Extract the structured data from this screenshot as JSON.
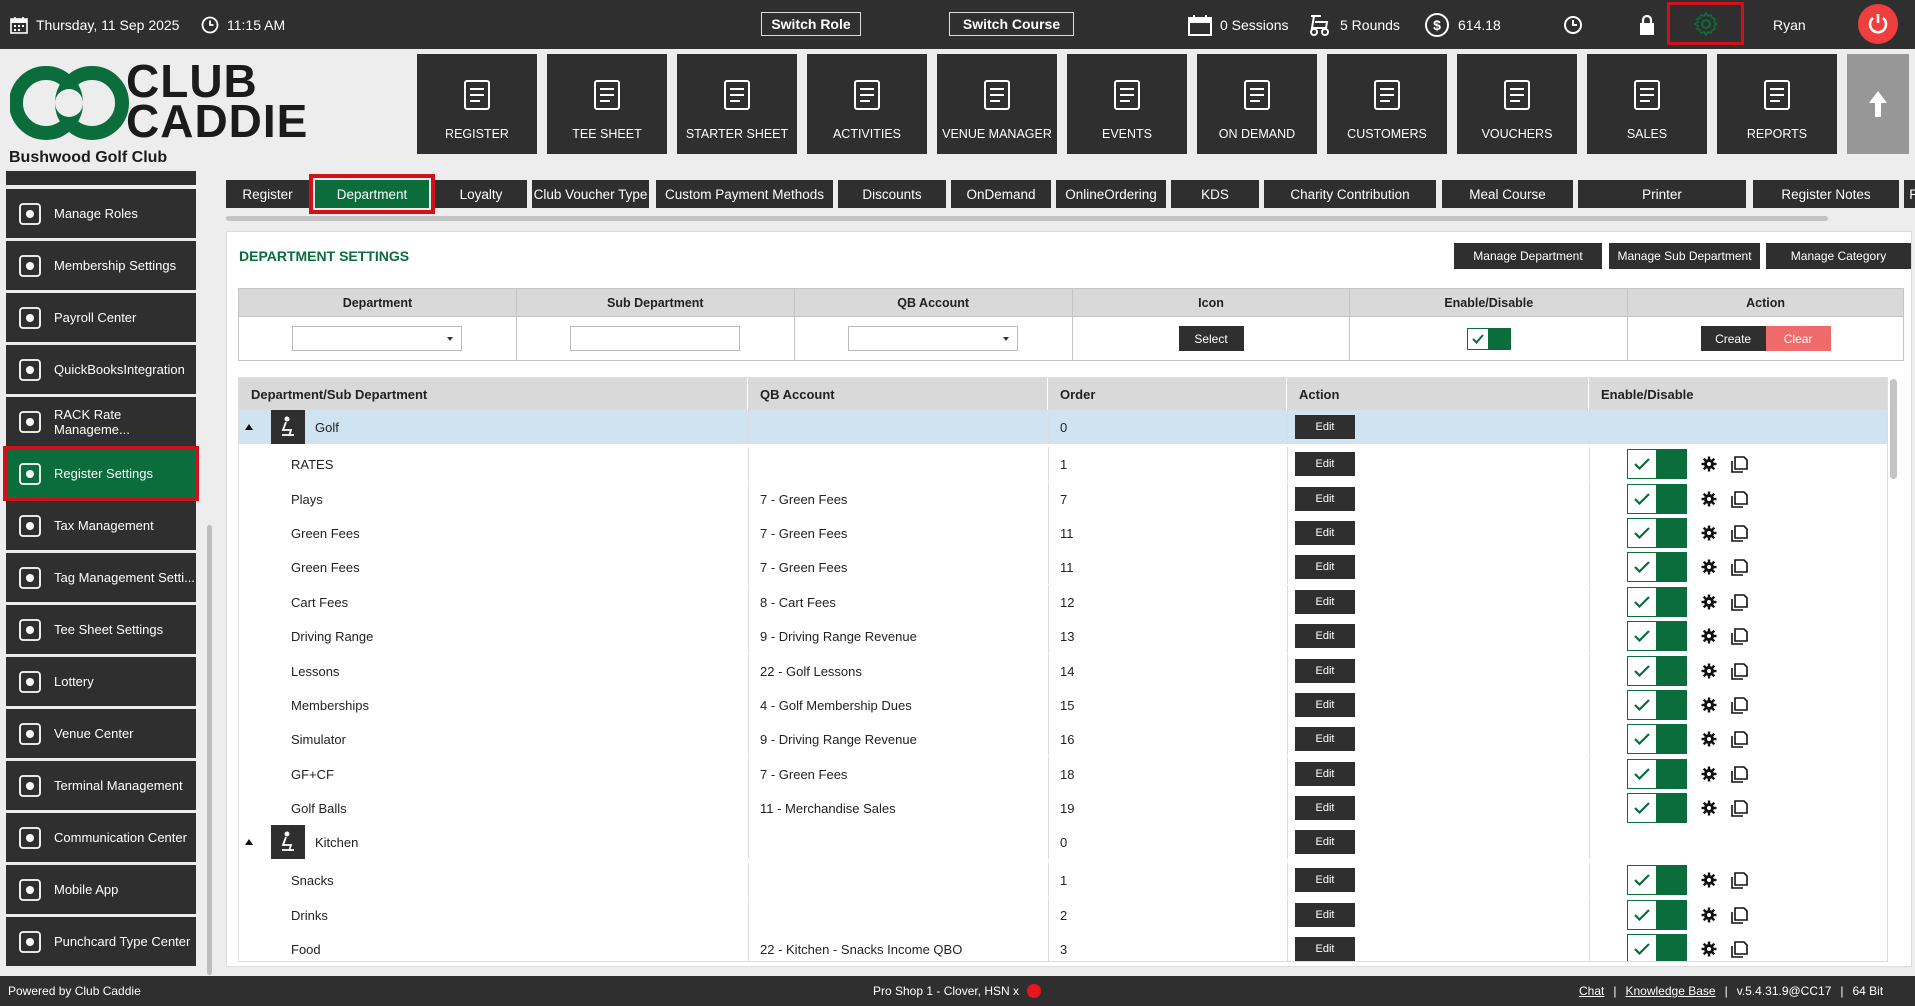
{
  "topbar": {
    "date": "Thursday,  11 Sep 2025",
    "time": "11:15 AM",
    "switch_role": "Switch Role",
    "switch_course": "Switch Course",
    "sessions": "0 Sessions",
    "rounds": "5 Rounds",
    "balance": "614.18",
    "user": "Ryan"
  },
  "brand": {
    "line1": "CLUB",
    "line2": "CADDIE",
    "club_name": "Bushwood Golf Club",
    "accent_color": "#0a6d3b"
  },
  "modules": [
    {
      "label": "REGISTER",
      "icon": "scanner-icon"
    },
    {
      "label": "TEE SHEET",
      "icon": "flag-icon"
    },
    {
      "label": "STARTER SHEET",
      "icon": "tablet-icon"
    },
    {
      "label": "ACTIVITIES",
      "icon": "calendar-list-icon"
    },
    {
      "label": "VENUE MANAGER",
      "icon": "venue-icon"
    },
    {
      "label": "EVENTS",
      "icon": "events-calendar-icon"
    },
    {
      "label": "ON DEMAND",
      "icon": "mobile-icon"
    },
    {
      "label": "CUSTOMERS",
      "icon": "users-icon"
    },
    {
      "label": "VOUCHERS",
      "icon": "voucher-icon"
    },
    {
      "label": "SALES",
      "icon": "sales-icon"
    },
    {
      "label": "REPORTS",
      "icon": "report-icon"
    }
  ],
  "sidebar": {
    "items": [
      {
        "label": "Manage Roles",
        "icon": "roles-icon"
      },
      {
        "label": "Membership Settings",
        "icon": "gear-icon"
      },
      {
        "label": "Payroll Center",
        "icon": "clock-icon"
      },
      {
        "label": "QuickBooksIntegration",
        "icon": "quickbooks-icon"
      },
      {
        "label": "RACK Rate Manageme...",
        "icon": "rack-rate-icon"
      },
      {
        "label": "Register Settings",
        "icon": "register-settings-icon"
      },
      {
        "label": "Tax Management",
        "icon": "tax-icon"
      },
      {
        "label": "Tag Management Setti...",
        "icon": "tag-icon"
      },
      {
        "label": "Tee Sheet Settings",
        "icon": "tee-icon"
      },
      {
        "label": "Lottery",
        "icon": "lottery-icon"
      },
      {
        "label": "Venue Center",
        "icon": "venue-icon"
      },
      {
        "label": "Terminal Management",
        "icon": "terminal-icon"
      },
      {
        "label": "Communication Center",
        "icon": "communication-icon"
      },
      {
        "label": "Mobile App",
        "icon": "mobile-app-icon"
      },
      {
        "label": "Punchcard Type Center",
        "icon": "punchcard-icon"
      }
    ]
  },
  "tabs": [
    "Register",
    "Department",
    "Loyalty",
    "Club Voucher Type",
    "Custom Payment Methods",
    "Discounts",
    "OnDemand",
    "OnlineOrdering",
    "KDS",
    "Charity Contribution",
    "Meal Course",
    "Printer",
    "Register Notes",
    "Paymen"
  ],
  "dept": {
    "title": "DEPARTMENT SETTINGS",
    "manage_department": "Manage Department",
    "manage_sub_department": "Manage Sub Department",
    "manage_category": "Manage Category",
    "form_headers": [
      "Department",
      "Sub Department",
      "QB Account",
      "Icon",
      "Enable/Disable",
      "Action"
    ],
    "select_label": "Select",
    "create_label": "Create",
    "clear_label": "Clear"
  },
  "list": {
    "headers": [
      "Department/Sub Department",
      "QB Account",
      "Order",
      "Action",
      "Enable/Disable"
    ],
    "edit_label": "Edit",
    "rows": [
      {
        "name": "Golf",
        "qb": "",
        "order": "0",
        "group": true,
        "icon": "golfer-icon"
      },
      {
        "name": "RATES",
        "qb": "",
        "order": "1"
      },
      {
        "name": "Plays",
        "qb": "7 - Green Fees",
        "order": "7"
      },
      {
        "name": "Green Fees",
        "qb": "7 - Green Fees",
        "order": "11"
      },
      {
        "name": "Green Fees",
        "qb": "7 - Green Fees",
        "order": "11"
      },
      {
        "name": "Cart Fees",
        "qb": "8 - Cart Fees",
        "order": "12"
      },
      {
        "name": "Driving Range",
        "qb": "9 - Driving Range Revenue",
        "order": "13"
      },
      {
        "name": "Lessons",
        "qb": "22 - Golf Lessons",
        "order": "14"
      },
      {
        "name": "Memberships",
        "qb": "4 - Golf Membership Dues",
        "order": "15"
      },
      {
        "name": "Simulator",
        "qb": "9 - Driving Range Revenue",
        "order": "16"
      },
      {
        "name": "GF+CF",
        "qb": "7 - Green Fees",
        "order": "18"
      },
      {
        "name": "Golf Balls",
        "qb": "11 - Merchandise Sales",
        "order": "19"
      },
      {
        "name": "Kitchen",
        "qb": "",
        "order": "0",
        "group": true,
        "icon": "kitchen-icon"
      },
      {
        "name": "Snacks",
        "qb": "",
        "order": "1"
      },
      {
        "name": "Drinks",
        "qb": "",
        "order": "2"
      },
      {
        "name": "Food",
        "qb": "22 - Kitchen - Snacks Income QBO",
        "order": "3"
      }
    ]
  },
  "footer": {
    "powered": "Powered by Club Caddie",
    "station": "Pro Shop 1 - Clover, HSN x",
    "chat": "Chat",
    "sep1": "|",
    "kb": "Knowledge Base",
    "sep2": "|",
    "version": "v.5.4.31.9@CC17",
    "sep3": "|",
    "bits": "64 Bit"
  }
}
